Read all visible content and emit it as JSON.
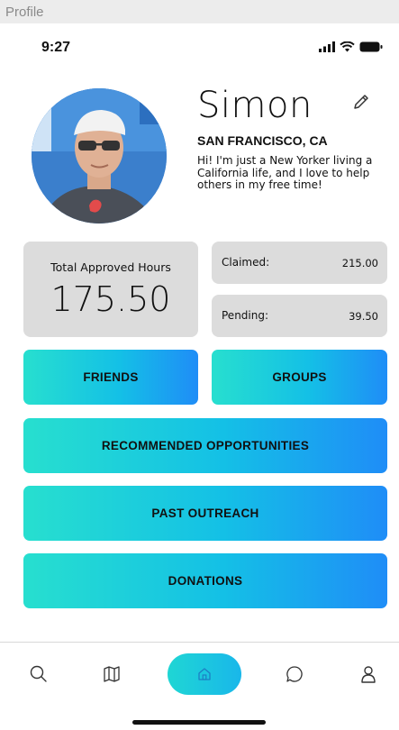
{
  "window": {
    "title": "Profile"
  },
  "status_bar": {
    "time": "9:27"
  },
  "profile": {
    "name": "Simon",
    "location": "SAN FRANCISCO, CA",
    "bio": "Hi! I'm just a New Yorker living a California life, and I love to help others in my free time!"
  },
  "stats": {
    "total_label": "Total Approved Hours",
    "total_value": "175.50",
    "claimed_label": "Claimed:",
    "claimed_value": "215.00",
    "pending_label": "Pending:",
    "pending_value": "39.50"
  },
  "buttons": {
    "friends": "FRIENDS",
    "groups": "GROUPS",
    "recommended": "RECOMMENDED OPPORTUNITIES",
    "past_outreach": "PAST OUTREACH",
    "donations": "DONATIONS"
  },
  "nav": {
    "items": [
      "search-icon",
      "map-icon",
      "home-icon",
      "chat-icon",
      "profile-icon"
    ],
    "active": "home-icon"
  },
  "colors": {
    "gradient_start": "#27dfcf",
    "gradient_end": "#1f8df7",
    "card_bg": "#dcdcdc"
  }
}
